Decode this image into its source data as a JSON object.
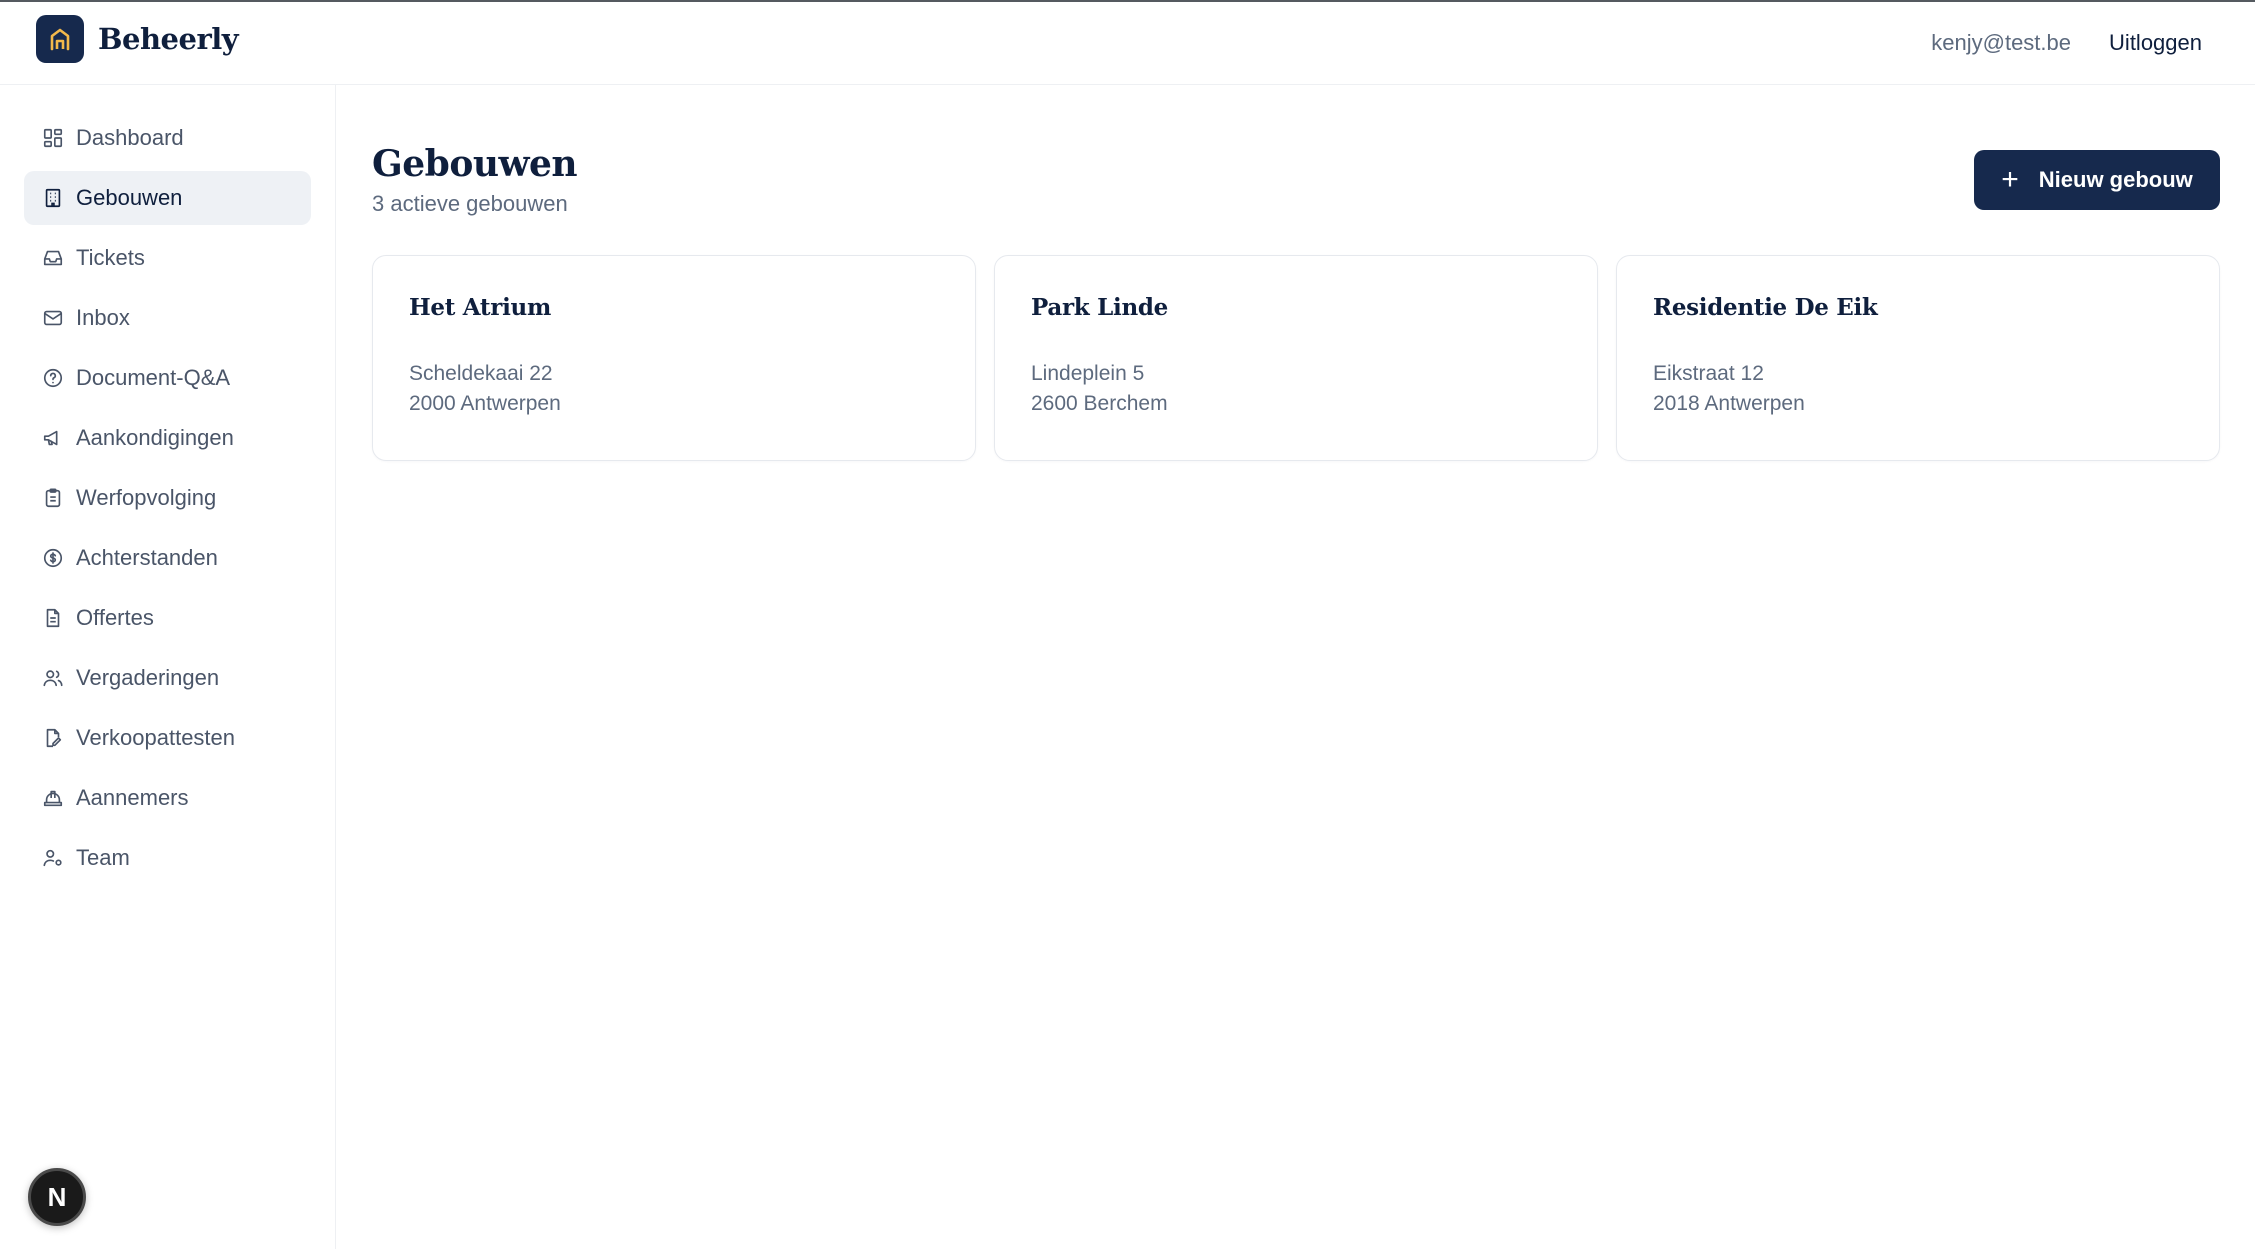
{
  "header": {
    "brand": "Beheerly",
    "user_email": "kenjy@test.be",
    "logout_label": "Uitloggen"
  },
  "sidebar": {
    "items": [
      {
        "label": "Dashboard",
        "icon": "dashboard-icon"
      },
      {
        "label": "Gebouwen",
        "icon": "building-icon",
        "active": true
      },
      {
        "label": "Tickets",
        "icon": "inbox-tray-icon"
      },
      {
        "label": "Inbox",
        "icon": "mail-icon"
      },
      {
        "label": "Document-Q&A",
        "icon": "help-circle-icon"
      },
      {
        "label": "Aankondigingen",
        "icon": "megaphone-icon"
      },
      {
        "label": "Werfopvolging",
        "icon": "clipboard-icon"
      },
      {
        "label": "Achterstanden",
        "icon": "dollar-circle-icon"
      },
      {
        "label": "Offertes",
        "icon": "file-text-icon"
      },
      {
        "label": "Vergaderingen",
        "icon": "users-icon"
      },
      {
        "label": "Verkoopattesten",
        "icon": "file-edit-icon"
      },
      {
        "label": "Aannemers",
        "icon": "hard-hat-icon"
      },
      {
        "label": "Team",
        "icon": "user-cog-icon"
      }
    ],
    "badge_letter": "N"
  },
  "main": {
    "title": "Gebouwen",
    "subtitle": "3 actieve gebouwen",
    "new_button_label": "Nieuw gebouw",
    "buildings": [
      {
        "name": "Het Atrium",
        "street": "Scheldekaai 22",
        "city": "2000 Antwerpen"
      },
      {
        "name": "Park Linde",
        "street": "Lindeplein 5",
        "city": "2600 Berchem"
      },
      {
        "name": "Residentie De Eik",
        "street": "Eikstraat 12",
        "city": "2018 Antwerpen"
      }
    ]
  },
  "colors": {
    "brand_navy": "#16294d",
    "logo_accent": "#f2b84b",
    "text_primary": "#0f1f3d",
    "text_muted": "#5d6a7e",
    "active_bg": "#eef1f5"
  }
}
